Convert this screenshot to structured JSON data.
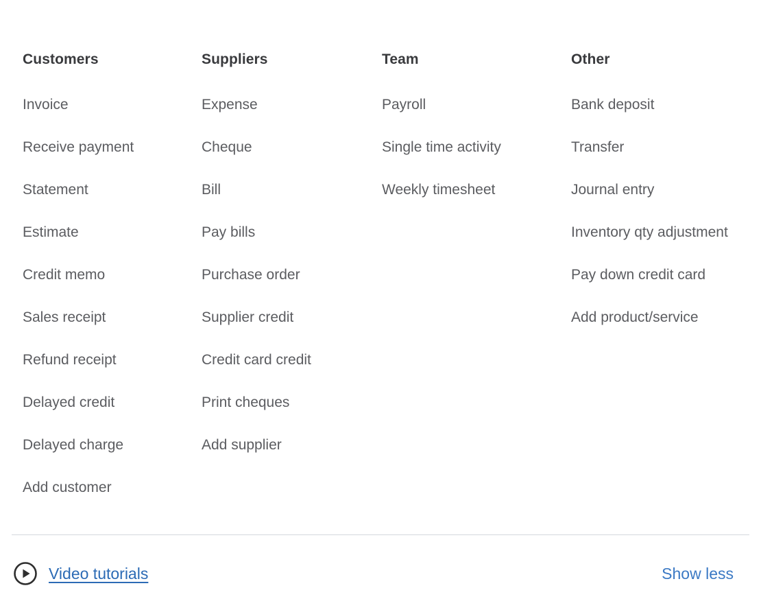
{
  "panel": {
    "background_color": "#ffffff",
    "header_text_color": "#393a3d",
    "item_text_color": "#5b5c60",
    "link_color": "#2c6bb5",
    "divider_color": "#d4d7dc"
  },
  "columns": [
    {
      "header": "Customers",
      "items": [
        "Invoice",
        "Receive payment",
        "Statement",
        "Estimate",
        "Credit memo",
        "Sales receipt",
        "Refund receipt",
        "Delayed credit",
        "Delayed charge",
        "Add customer"
      ]
    },
    {
      "header": "Suppliers",
      "items": [
        "Expense",
        "Cheque",
        "Bill",
        "Pay bills",
        "Purchase order",
        "Supplier credit",
        "Credit card credit",
        "Print cheques",
        "Add supplier"
      ]
    },
    {
      "header": "Team",
      "items": [
        "Payroll",
        "Single time activity",
        "Weekly timesheet"
      ]
    },
    {
      "header": "Other",
      "items": [
        "Bank deposit",
        "Transfer",
        "Journal entry",
        "Inventory qty adjustment",
        "Pay down credit card",
        "Add product/service"
      ]
    }
  ],
  "footer": {
    "video_tutorials_label": "Video tutorials",
    "video_tutorials_icon": "play-circle-icon",
    "show_less_label": "Show less"
  }
}
